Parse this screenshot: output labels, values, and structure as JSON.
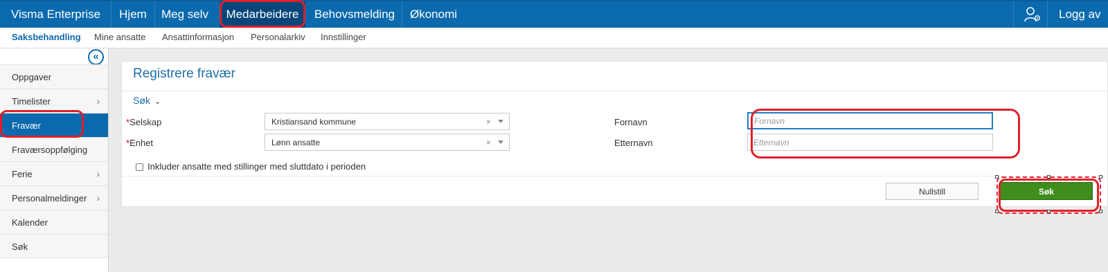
{
  "topnav": {
    "brand": "Visma Enterprise",
    "items": [
      {
        "label": "Hjem"
      },
      {
        "label": "Meg selv"
      },
      {
        "label": "Medarbeidere"
      },
      {
        "label": "Behovsmelding"
      },
      {
        "label": "Økonomi"
      }
    ],
    "active_item": "Medarbeidere",
    "user_icon": "user-settings-icon",
    "logout_label": "Logg av"
  },
  "subnav": {
    "items": [
      {
        "label": "Saksbehandling"
      },
      {
        "label": "Mine ansatte"
      },
      {
        "label": "Ansattinformasjon"
      },
      {
        "label": "Personalarkiv"
      },
      {
        "label": "Innstillinger"
      }
    ],
    "active_item": "Saksbehandling"
  },
  "sidebar": {
    "collapse_icon": "double-chevron-left-icon",
    "collapse_glyph": "«",
    "items": [
      {
        "label": "Oppgaver",
        "chevron": ""
      },
      {
        "label": "Timelister",
        "chevron": "›"
      },
      {
        "label": "Fravær",
        "chevron": ""
      },
      {
        "label": "Fraværsoppfølging",
        "chevron": ""
      },
      {
        "label": "Ferie",
        "chevron": "›"
      },
      {
        "label": "Personalmeldinger",
        "chevron": "›"
      },
      {
        "label": "Kalender",
        "chevron": ""
      },
      {
        "label": "Søk",
        "chevron": ""
      }
    ],
    "active_item": "Fravær"
  },
  "form": {
    "title": "Registrere fravær",
    "search_toggle": "Søk",
    "caret": "⌄",
    "required_marker": "*",
    "company": {
      "label": "Selskap",
      "value": "Kristiansand kommune",
      "clear": "×"
    },
    "unit": {
      "label": "Enhet",
      "value": "Lønn ansatte",
      "clear": "×"
    },
    "firstname": {
      "label": "Fornavn",
      "value": "",
      "placeholder": "Fornavn"
    },
    "lastname": {
      "label": "Etternavn",
      "value": "",
      "placeholder": "Etternavn"
    },
    "include_ended": {
      "label": "Inkluder ansatte med stillinger med sluttdato i perioden",
      "checked": false
    },
    "reset_label": "Nullstill",
    "search_label": "Søk"
  },
  "colors": {
    "brand_blue": "#0b6aad",
    "active_nav": "#06467a",
    "primary_green": "#3f8d1d",
    "highlight_red": "#e0202a"
  }
}
